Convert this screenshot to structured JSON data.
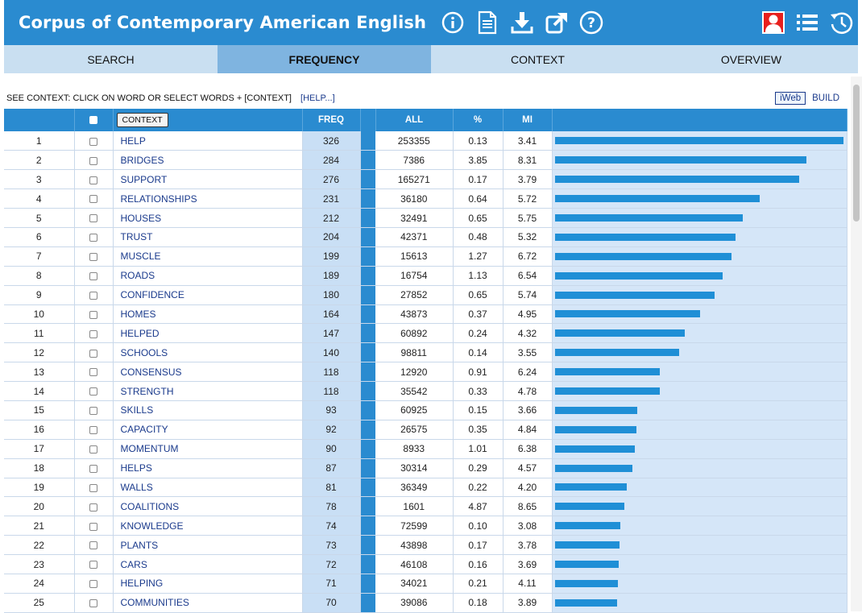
{
  "header": {
    "title": "Corpus of Contemporary American English",
    "icons": [
      "info-icon",
      "document-icon",
      "download-icon",
      "share-icon",
      "help-icon"
    ],
    "right_icons": [
      "user-icon",
      "list-icon",
      "history-icon"
    ]
  },
  "tabs": [
    {
      "label": "SEARCH"
    },
    {
      "label": "FREQUENCY"
    },
    {
      "label": "CONTEXT"
    },
    {
      "label": "OVERVIEW"
    }
  ],
  "info": {
    "text": "SEE CONTEXT: CLICK ON WORD OR SELECT WORDS + [CONTEXT]",
    "help": "[HELP...]",
    "iweb": "iWeb",
    "build": "BUILD"
  },
  "table": {
    "headers": {
      "context": "CONTEXT",
      "freq": "FREQ",
      "all": "ALL",
      "pct": "%",
      "mi": "MI"
    },
    "rows": [
      {
        "n": "1",
        "word": "HELP",
        "freq": 326,
        "all": "253355",
        "pct": "0.13",
        "mi": "3.41"
      },
      {
        "n": "2",
        "word": "BRIDGES",
        "freq": 284,
        "all": "7386",
        "pct": "3.85",
        "mi": "8.31"
      },
      {
        "n": "3",
        "word": "SUPPORT",
        "freq": 276,
        "all": "165271",
        "pct": "0.17",
        "mi": "3.79"
      },
      {
        "n": "4",
        "word": "RELATIONSHIPS",
        "freq": 231,
        "all": "36180",
        "pct": "0.64",
        "mi": "5.72"
      },
      {
        "n": "5",
        "word": "HOUSES",
        "freq": 212,
        "all": "32491",
        "pct": "0.65",
        "mi": "5.75"
      },
      {
        "n": "6",
        "word": "TRUST",
        "freq": 204,
        "all": "42371",
        "pct": "0.48",
        "mi": "5.32"
      },
      {
        "n": "7",
        "word": "MUSCLE",
        "freq": 199,
        "all": "15613",
        "pct": "1.27",
        "mi": "6.72"
      },
      {
        "n": "8",
        "word": "ROADS",
        "freq": 189,
        "all": "16754",
        "pct": "1.13",
        "mi": "6.54"
      },
      {
        "n": "9",
        "word": "CONFIDENCE",
        "freq": 180,
        "all": "27852",
        "pct": "0.65",
        "mi": "5.74"
      },
      {
        "n": "10",
        "word": "HOMES",
        "freq": 164,
        "all": "43873",
        "pct": "0.37",
        "mi": "4.95"
      },
      {
        "n": "11",
        "word": "HELPED",
        "freq": 147,
        "all": "60892",
        "pct": "0.24",
        "mi": "4.32"
      },
      {
        "n": "12",
        "word": "SCHOOLS",
        "freq": 140,
        "all": "98811",
        "pct": "0.14",
        "mi": "3.55"
      },
      {
        "n": "13",
        "word": "CONSENSUS",
        "freq": 118,
        "all": "12920",
        "pct": "0.91",
        "mi": "6.24"
      },
      {
        "n": "14",
        "word": "STRENGTH",
        "freq": 118,
        "all": "35542",
        "pct": "0.33",
        "mi": "4.78"
      },
      {
        "n": "15",
        "word": "SKILLS",
        "freq": 93,
        "all": "60925",
        "pct": "0.15",
        "mi": "3.66"
      },
      {
        "n": "16",
        "word": "CAPACITY",
        "freq": 92,
        "all": "26575",
        "pct": "0.35",
        "mi": "4.84"
      },
      {
        "n": "17",
        "word": "MOMENTUM",
        "freq": 90,
        "all": "8933",
        "pct": "1.01",
        "mi": "6.38"
      },
      {
        "n": "18",
        "word": "HELPS",
        "freq": 87,
        "all": "30314",
        "pct": "0.29",
        "mi": "4.57"
      },
      {
        "n": "19",
        "word": "WALLS",
        "freq": 81,
        "all": "36349",
        "pct": "0.22",
        "mi": "4.20"
      },
      {
        "n": "20",
        "word": "COALITIONS",
        "freq": 78,
        "all": "1601",
        "pct": "4.87",
        "mi": "8.65"
      },
      {
        "n": "21",
        "word": "KNOWLEDGE",
        "freq": 74,
        "all": "72599",
        "pct": "0.10",
        "mi": "3.08"
      },
      {
        "n": "22",
        "word": "PLANTS",
        "freq": 73,
        "all": "43898",
        "pct": "0.17",
        "mi": "3.78"
      },
      {
        "n": "23",
        "word": "CARS",
        "freq": 72,
        "all": "46108",
        "pct": "0.16",
        "mi": "3.69"
      },
      {
        "n": "24",
        "word": "HELPING",
        "freq": 71,
        "all": "34021",
        "pct": "0.21",
        "mi": "4.11"
      },
      {
        "n": "25",
        "word": "COMMUNITIES",
        "freq": 70,
        "all": "39086",
        "pct": "0.18",
        "mi": "3.89"
      }
    ]
  },
  "colors": {
    "header": "#2a8bd0",
    "tab": "#c9dff1",
    "tab_active": "#7fb4e0",
    "bar": "#1f8fd6",
    "link": "#1a3a8c"
  }
}
